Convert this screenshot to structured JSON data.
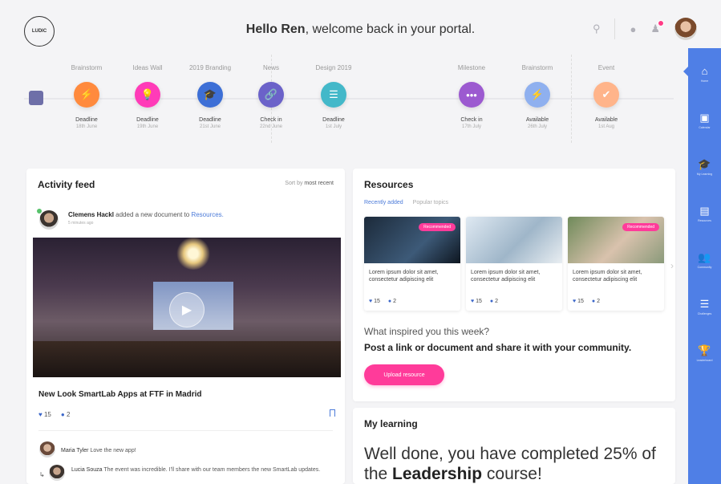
{
  "header": {
    "logo_text": "LUDIC",
    "greeting_name": "Hello Ren",
    "greeting_rest": ", welcome back in your portal."
  },
  "timeline": [
    {
      "title": "Brainstorm",
      "status": "Deadline",
      "date": "18th June",
      "color": "#ff8a3d",
      "icon": "⚡"
    },
    {
      "title": "Ideas Wall",
      "status": "Deadline",
      "date": "19th June",
      "color": "#ff3bb8",
      "icon": "💡"
    },
    {
      "title": "2019 Branding",
      "status": "Deadline",
      "date": "21st June",
      "color": "#3d6fd6",
      "icon": "🎓"
    },
    {
      "title": "News",
      "status": "Check in",
      "date": "22nd June",
      "color": "#6b62c9",
      "icon": "🔗"
    },
    {
      "title": "Design 2019",
      "status": "Deadline",
      "date": "1st July",
      "color": "#43b8c9",
      "icon": "☰"
    },
    {
      "title": "Milestone",
      "status": "Check in",
      "date": "17th July",
      "color": "#9c5ad0",
      "icon": "•••"
    },
    {
      "title": "Brainstorm",
      "status": "Available",
      "date": "26th July",
      "color": "#8fb0ef",
      "icon": "⚡"
    },
    {
      "title": "Event",
      "status": "Available",
      "date": "1st Aug",
      "color": "#ffb48a",
      "icon": "✔"
    }
  ],
  "feed": {
    "title": "Activity feed",
    "sort_label": "Sort by",
    "sort_value": "most recent",
    "author": "Clemens Hackl",
    "action": " added a new document to ",
    "link": "Resources.",
    "time": "5 minutes ago",
    "post_title": "New Look SmartLab Apps at FTF in Madrid",
    "likes": "15",
    "comments": "2",
    "comment1_author": "Maria Tyler",
    "comment1_text": " Love the new app!",
    "comment2_author": "Lucia Souza",
    "comment2_text": " The event was incredible. I'll share with our team members the new SmartLab updates."
  },
  "resources": {
    "title": "Resources",
    "tab_active": "Recently added",
    "tab_other": "Popular topics",
    "cards": [
      {
        "badge": "Recommended",
        "text": "Lorem ipsum dolor sit amet, consectetur adipiscing elit",
        "likes": "15",
        "comments": "2"
      },
      {
        "badge": "",
        "text": "Lorem ipsum dolor sit amet, consectetur adipiscing elit",
        "likes": "15",
        "comments": "2"
      },
      {
        "badge": "Recommended",
        "text": "Lorem ipsum dolor sit amet, consectetur adipiscing elit",
        "likes": "15",
        "comments": "2"
      }
    ],
    "prompt_question": "What inspired you this week?",
    "prompt_cta": "Post a link or document and share it with your community.",
    "upload_label": "Upload resource"
  },
  "learning": {
    "title": "My learning",
    "text_before": "Well done, you have completed 25% of the ",
    "course": "Leadership",
    "text_after": " course!"
  },
  "sidebar": [
    {
      "icon": "home-icon",
      "glyph": "⌂",
      "label": "Home"
    },
    {
      "icon": "calendar-icon",
      "glyph": "▣",
      "label": "Calendar"
    },
    {
      "icon": "graduation-icon",
      "glyph": "🎓",
      "label": "My Learning"
    },
    {
      "icon": "documents-icon",
      "glyph": "▤",
      "label": "Resources"
    },
    {
      "icon": "community-icon",
      "glyph": "👥",
      "label": "Community"
    },
    {
      "icon": "list-icon",
      "glyph": "☰",
      "label": "Challenges"
    },
    {
      "icon": "trophy-icon",
      "glyph": "🏆",
      "label": "Leaderboard"
    }
  ]
}
